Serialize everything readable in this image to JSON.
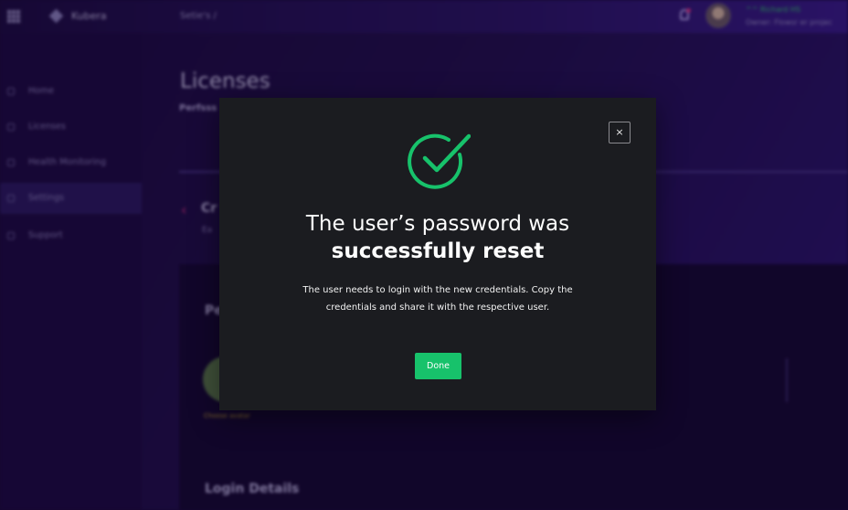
{
  "app": {
    "brand_name": "Kubera",
    "breadcrumb": "Setie's  /",
    "user": {
      "name": "^^ Richard HS",
      "role": "Owner: Flowsr er projec"
    }
  },
  "sidebar": {
    "items": [
      {
        "label": "Home",
        "icon": "home-icon"
      },
      {
        "label": "Licenses",
        "icon": "license-icon"
      },
      {
        "label": "Health Monitoring",
        "icon": "pulse-icon"
      },
      {
        "label": "Settings",
        "icon": "settings-icon",
        "active": true
      },
      {
        "label": "Support",
        "icon": "support-icon"
      }
    ]
  },
  "main": {
    "title": "Licenses",
    "subtitle": "Perfsss",
    "section_title": "Cr",
    "section_subtitle": "Ea",
    "card_heading": "Pe",
    "choose_avatar": "Choose avatar",
    "login_heading": "Login Details"
  },
  "modal": {
    "title_line1": "The user’s password was",
    "title_line2": "successfully reset",
    "message": "The user needs to login with the new credentials. Copy the credentials and share it with the respective user.",
    "done_label": "Done",
    "close_label": "×",
    "icon": "check-circle-icon"
  },
  "colors": {
    "accent_green": "#17c26b",
    "modal_bg": "#1b1c20",
    "page_bg": "#1a0b3a"
  }
}
